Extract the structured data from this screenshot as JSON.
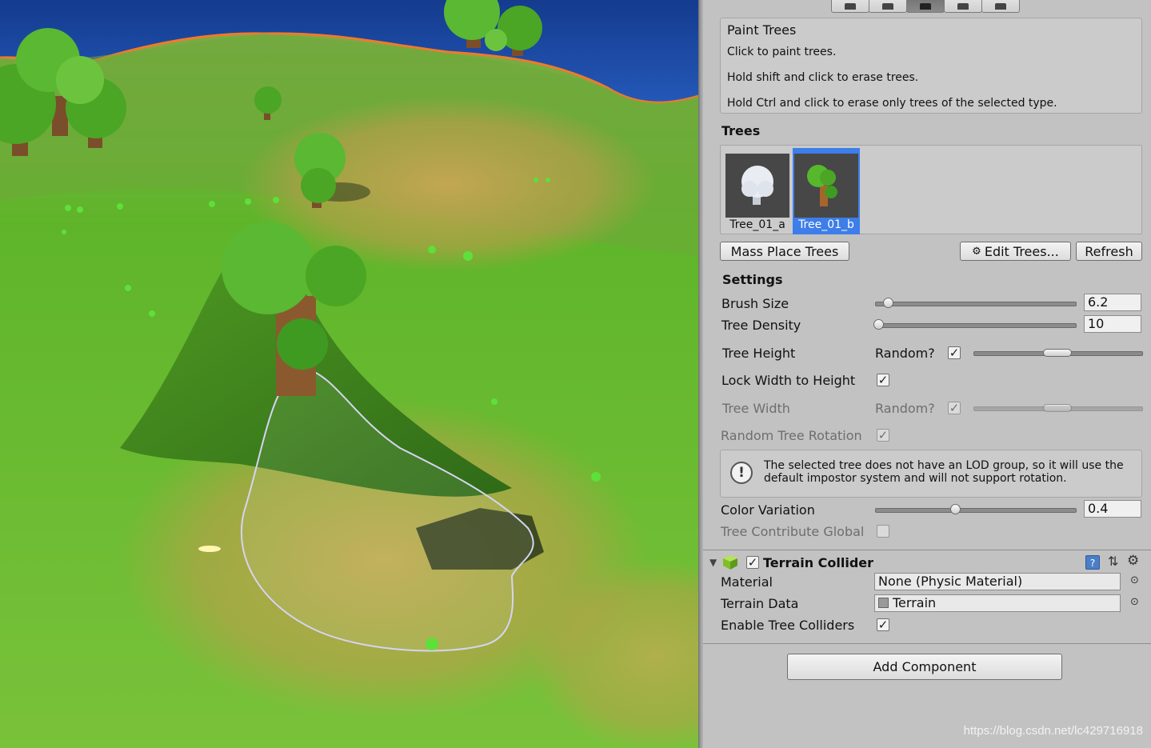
{
  "inspector": {
    "paint_trees": {
      "title": "Paint Trees",
      "lines": [
        "Click to paint trees.",
        "Hold shift and click to erase trees.",
        "Hold Ctrl and click to erase only trees of the selected type."
      ]
    },
    "trees_header": "Trees",
    "trees": [
      {
        "name": "Tree_01_a",
        "selected": false
      },
      {
        "name": "Tree_01_b",
        "selected": true
      }
    ],
    "buttons": {
      "mass_place": "Mass Place Trees",
      "edit_trees": "Edit Trees...",
      "refresh": "Refresh"
    },
    "settings": {
      "header": "Settings",
      "brush_size": {
        "label": "Brush Size",
        "value": "6.2"
      },
      "tree_density": {
        "label": "Tree Density",
        "value": "10"
      },
      "tree_height": {
        "label": "Tree Height",
        "random_label": "Random?",
        "random_checked": true
      },
      "lock_width": {
        "label": "Lock Width to Height",
        "checked": true
      },
      "tree_width": {
        "label": "Tree Width",
        "random_label": "Random?",
        "random_checked": true
      },
      "random_rotation": {
        "label": "Random Tree Rotation",
        "checked": true
      },
      "warning": "The selected tree does not have an LOD group, so it will use the default impostor system and will not support rotation.",
      "color_variation": {
        "label": "Color Variation",
        "value": "0.4"
      },
      "contribute_gi": {
        "label": "Tree Contribute Global",
        "checked": false
      }
    },
    "terrain_collider": {
      "title": "Terrain Collider",
      "enabled": true,
      "material_label": "Material",
      "material_value": "None (Physic Material)",
      "terrain_data_label": "Terrain Data",
      "terrain_data_value": "Terrain",
      "enable_tree_colliders_label": "Enable Tree Colliders",
      "enable_tree_colliders": true
    },
    "add_component": "Add Component"
  },
  "watermark": "https://blog.csdn.net/lc429716918",
  "colors": {
    "selection_blue": "#3d7ee8",
    "panel_bg": "#c2c2c2",
    "terrain_green": "#5cb82a",
    "water_blue": "#1f4aa8",
    "outline_orange": "#f07a2a"
  }
}
